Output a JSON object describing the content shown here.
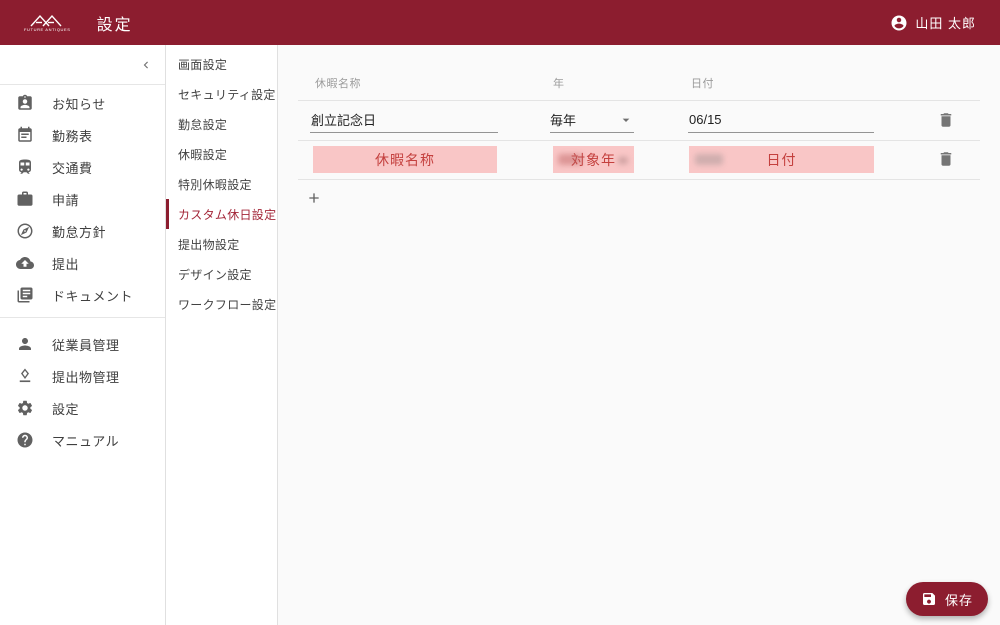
{
  "header": {
    "brand": "FUTURE ANTIQUES",
    "title": "設定",
    "user_name": "山田 太郎"
  },
  "sidebar": {
    "primary_items": [
      {
        "label": "お知らせ",
        "icon": "clipboard-person-icon"
      },
      {
        "label": "勤務表",
        "icon": "calendar-icon"
      },
      {
        "label": "交通費",
        "icon": "train-icon"
      },
      {
        "label": "申請",
        "icon": "briefcase-icon"
      },
      {
        "label": "勤怠方針",
        "icon": "compass-icon"
      },
      {
        "label": "提出",
        "icon": "cloud-upload-icon"
      },
      {
        "label": "ドキュメント",
        "icon": "documents-icon"
      }
    ],
    "secondary_items": [
      {
        "label": "従業員管理",
        "icon": "person-icon"
      },
      {
        "label": "提出物管理",
        "icon": "approval-icon"
      },
      {
        "label": "設定",
        "icon": "gear-icon"
      },
      {
        "label": "マニュアル",
        "icon": "help-icon"
      }
    ]
  },
  "settings_menu": {
    "items": [
      {
        "label": "画面設定",
        "active": false
      },
      {
        "label": "セキュリティ設定",
        "active": false
      },
      {
        "label": "勤怠設定",
        "active": false
      },
      {
        "label": "休暇設定",
        "active": false
      },
      {
        "label": "特別休暇設定",
        "active": false
      },
      {
        "label": "カスタム休日設定",
        "active": true
      },
      {
        "label": "提出物設定",
        "active": false
      },
      {
        "label": "デザイン設定",
        "active": false
      },
      {
        "label": "ワークフロー設定",
        "active": false
      }
    ]
  },
  "main": {
    "table": {
      "columns": [
        "休暇名称",
        "年",
        "日付"
      ],
      "rows": [
        {
          "name": "創立記念日",
          "year": "毎年",
          "date": "06/15"
        }
      ],
      "annotated_row": {
        "name_label": "休暇名称",
        "year_label": "対象年",
        "date_label": "日付"
      }
    },
    "save_button": {
      "label": "保存"
    }
  },
  "colors": {
    "accent": "#8C1D2F",
    "active_text": "#A32638",
    "overlay_bg": "#F9C6C6",
    "overlay_text": "#C4403E"
  }
}
